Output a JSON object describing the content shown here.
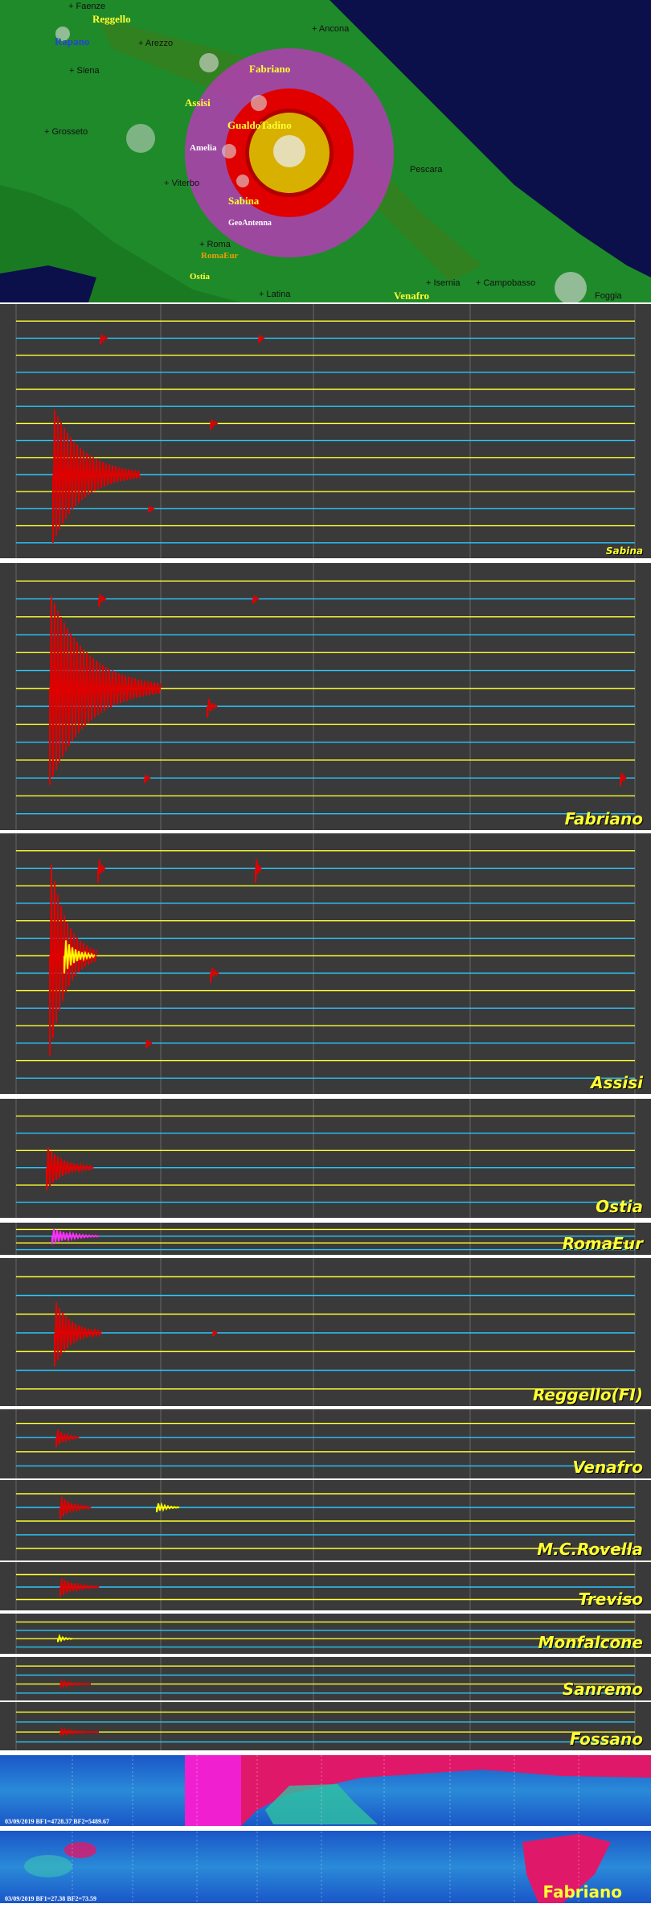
{
  "map": {
    "colors": {
      "sea": "#0b0f4a",
      "land": "#1f8a2a",
      "mountain": "#3a7d1c",
      "quake_outer": "#b43cb4",
      "quake_red": "#e00000",
      "quake_core": "#d8b000"
    },
    "labels": [
      {
        "text": "Reggello"
      },
      {
        "text": "Fabriano"
      },
      {
        "text": "Assisi"
      },
      {
        "text": "GualdoTadino"
      },
      {
        "text": "Amelia"
      },
      {
        "text": "Sabina"
      },
      {
        "text": "GeoAntenna"
      },
      {
        "text": "Ostia"
      },
      {
        "text": "RomaEur"
      },
      {
        "text": "Venafro"
      }
    ],
    "cities": [
      {
        "text": "+ Faenze"
      },
      {
        "text": "+ Arezzo"
      },
      {
        "text": "+ Siena"
      },
      {
        "text": "+ Grosseto"
      },
      {
        "text": "+ Ancona"
      },
      {
        "text": "+ Viterbo"
      },
      {
        "text": "+ Roma"
      },
      {
        "text": "+ Latina"
      },
      {
        "text": "+ Isernia"
      },
      {
        "text": "+ Campobasso"
      },
      {
        "text": "Foggia"
      },
      {
        "text": "Pescara"
      }
    ],
    "blue_label": "Rapano"
  },
  "stations": [
    {
      "id": "sabina",
      "name": "Sabina"
    },
    {
      "id": "fabriano",
      "name": "Fabriano"
    },
    {
      "id": "assisi",
      "name": "Assisi"
    },
    {
      "id": "ostia",
      "name": "Ostia"
    },
    {
      "id": "romaeur",
      "name": "RomaEur"
    },
    {
      "id": "reggello",
      "name": "Reggello(FI)"
    },
    {
      "id": "venafro",
      "name": "Venafro"
    },
    {
      "id": "mcrovella",
      "name": "M.C.Rovella"
    },
    {
      "id": "treviso",
      "name": "Treviso"
    },
    {
      "id": "monfalcone",
      "name": "Monfalcone"
    },
    {
      "id": "sanremo",
      "name": "Sanremo"
    },
    {
      "id": "fossano",
      "name": "Fossano"
    }
  ],
  "spectrogram": {
    "top_caption": "03/09/2019 BF1=4728.37 BF2=5489.67",
    "bottom_caption": "03/09/2019 BF1=27.38 BF2=73.59",
    "title": "Fabriano"
  }
}
